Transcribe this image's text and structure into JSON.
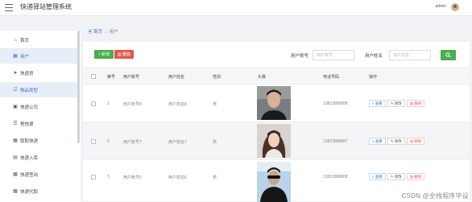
{
  "header": {
    "app_title": "快递驿站管理系统",
    "username": "admin"
  },
  "sidebar": {
    "items": [
      {
        "label": "首页",
        "icon": "home-icon"
      },
      {
        "label": "用户",
        "icon": "grid-icon",
        "active": true
      },
      {
        "label": "快递员",
        "icon": "send-icon"
      },
      {
        "label": "物品类型",
        "icon": "checkbox-icon",
        "active_light": true
      },
      {
        "label": "快递公司",
        "icon": "chat-icon"
      },
      {
        "label": "寄快递",
        "icon": "list-icon"
      },
      {
        "label": "取取快递",
        "icon": "grid-icon"
      },
      {
        "label": "快递入库",
        "icon": "chart-icon"
      },
      {
        "label": "快递签出",
        "icon": "grid-icon"
      },
      {
        "label": "快递代取",
        "icon": "grid-icon"
      }
    ]
  },
  "breadcrumb": {
    "home": "首页",
    "separator": "→",
    "current": "用户"
  },
  "toolbar": {
    "add_label": "+ 新增",
    "delete_label": "删除",
    "search_account_label": "用户账号",
    "search_account_placeholder": "用户账号",
    "search_name_label": "用户姓名",
    "search_name_placeholder": "用户姓名"
  },
  "table": {
    "columns": [
      "索号",
      "用户账号",
      "用户姓名",
      "性别",
      "头像",
      "电话号码",
      "操作"
    ],
    "rows": [
      {
        "index": "1",
        "account": "用户账号8",
        "name": "用户姓名8",
        "gender": "男",
        "phone": "13823888888"
      },
      {
        "index": "2",
        "account": "用户账号7",
        "name": "用户姓名7",
        "gender": "男",
        "phone": "13823888887"
      },
      {
        "index": "3",
        "account": "用户账号6",
        "name": "用户姓名6",
        "gender": "男",
        "phone": "13823888888"
      }
    ],
    "actions": {
      "view": "查看",
      "edit": "修改",
      "remove": "删除"
    }
  },
  "watermark": "CSDN @全栈程序毕设",
  "colors": {
    "primary": "#3a72c4",
    "success": "#4cae4c",
    "danger": "#e05a4f"
  }
}
